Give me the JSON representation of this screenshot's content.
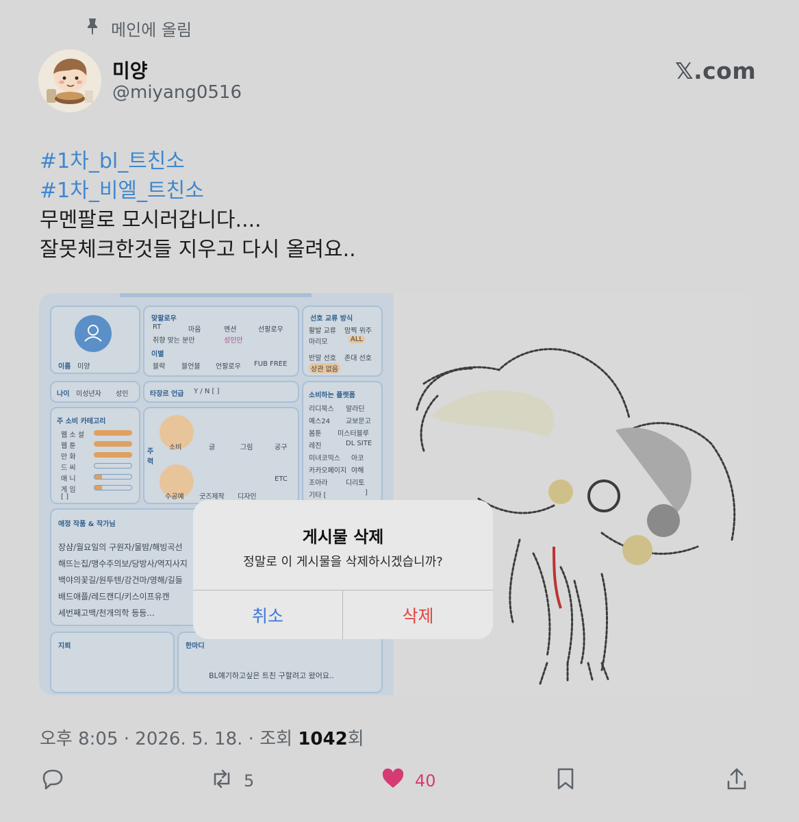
{
  "pinned": {
    "label": "메인에 올림",
    "icon": "pin-icon"
  },
  "author": {
    "name": "미양",
    "handle": "@miyang0516",
    "avatar": "avatar-image"
  },
  "brand": "𝕏.com",
  "tweet": {
    "hashtags": [
      "#1차_bl_트친소",
      "#1차_비엘_트친소"
    ],
    "lines": [
      "무멘팔로 모시러갑니다....",
      "잘못체크한것들 지우고 다시 올려요.."
    ]
  },
  "media": {
    "form": {
      "name_label": "이름",
      "name_value": "미양",
      "sec_follow": "맞팔로우",
      "follow_opts": [
        "RT",
        "마음",
        "멘션",
        "선팔로우",
        "취향 맞는 분만",
        "성인만"
      ],
      "sec_block": "이별",
      "block_opts": [
        "블락",
        "블언블",
        "언팔로우",
        "FUB FREE"
      ],
      "sec_pref": "선호 교류 방식",
      "pref_opts": [
        "활발 교류",
        "맘찍 위주",
        "마리모",
        "ALL",
        "반말 선호",
        "존대 선호",
        "상관 없음"
      ],
      "age_label": "나이",
      "age_opts": [
        "미성년자",
        "성인"
      ],
      "other_genre": "타장르 언급",
      "other_genre_val": "Y / N  [              ]",
      "platform_title": "소비하는 플랫폼",
      "platforms": [
        "리디북스",
        "알라딘",
        "예스24",
        "교보문고",
        "봄툰",
        "미스터블루",
        "레진",
        "DL SITE",
        "미녀코믹스",
        "아코",
        "카카오페이지",
        "야해",
        "조아라",
        "디리토",
        "기타 [",
        "]"
      ],
      "category_title": "주 소비 카테고리",
      "categories": [
        "웹 소 설",
        "웹   툰",
        "만   화",
        "드   씨",
        "애   니",
        "게   임",
        "[       ]"
      ],
      "activity_label": "주력",
      "activities": [
        "소비",
        "글",
        "그림",
        "공구",
        "수공예",
        "굿즈제작",
        "디자인",
        "ETC"
      ],
      "works_title": "애정 작품 & 작가님",
      "works": [
        "장샴/월요일의 구원자/물밤/해빙곡선",
        "해뜨는집/맹수주의보/당방사/역지사지",
        "백야의꽃길/원투텐/강건마/영해/길들",
        "배드애플/레드캔디/키스이프유캔",
        "세번째고백/천개의학 등등..."
      ],
      "landmine_title": "지뢰",
      "oneword_title": "한마디",
      "oneword_text": "BL얘기하고싶은 트친 구할려고 왔어요.."
    },
    "drawing": "sketch-illustration"
  },
  "dialog": {
    "title": "게시물 삭제",
    "message": "정말로 이 게시물을 삭제하시겠습니까?",
    "cancel": "취소",
    "delete": "삭제",
    "cancel_color": "#3b78d8",
    "delete_color": "#e0453e"
  },
  "meta": {
    "time": "오후 8:05 · 2026. 5. 18. · 조회 ",
    "views": "1042",
    "views_suffix": "회"
  },
  "actions": {
    "reply": {
      "icon": "reply-icon",
      "count": ""
    },
    "retweet": {
      "icon": "retweet-icon",
      "count": "5"
    },
    "like": {
      "icon": "heart-icon",
      "count": "40",
      "color": "#d63a73"
    },
    "bookmark": {
      "icon": "bookmark-icon"
    },
    "share": {
      "icon": "share-icon"
    }
  }
}
